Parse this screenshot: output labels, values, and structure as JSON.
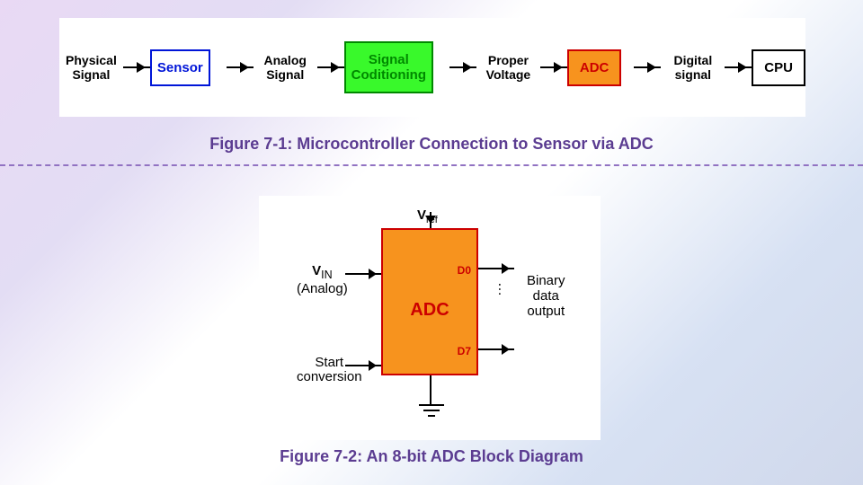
{
  "figure1": {
    "labels": {
      "physical": "Physical\nSignal",
      "analog": "Analog\nSignal",
      "proper": "Proper\nVoltage",
      "digital": "Digital\nsignal"
    },
    "boxes": {
      "sensor": "Sensor",
      "conditioning": "Signal\nCoditioning",
      "adc": "ADC",
      "cpu": "CPU"
    },
    "caption": "Figure 7‑1: Microcontroller Connection to Sensor via ADC"
  },
  "figure2": {
    "vref": "V",
    "vref_sub": "ref",
    "vin_line1": "V",
    "vin_sub": "IN",
    "vin_line2": "(Analog)",
    "start": "Start\nconversion",
    "adc": "ADC",
    "d0": "D0",
    "d7": "D7",
    "dots": "…",
    "output": "Binary\ndata\noutput",
    "caption": "Figure 7‑2: An 8‑bit ADC Block Diagram"
  }
}
